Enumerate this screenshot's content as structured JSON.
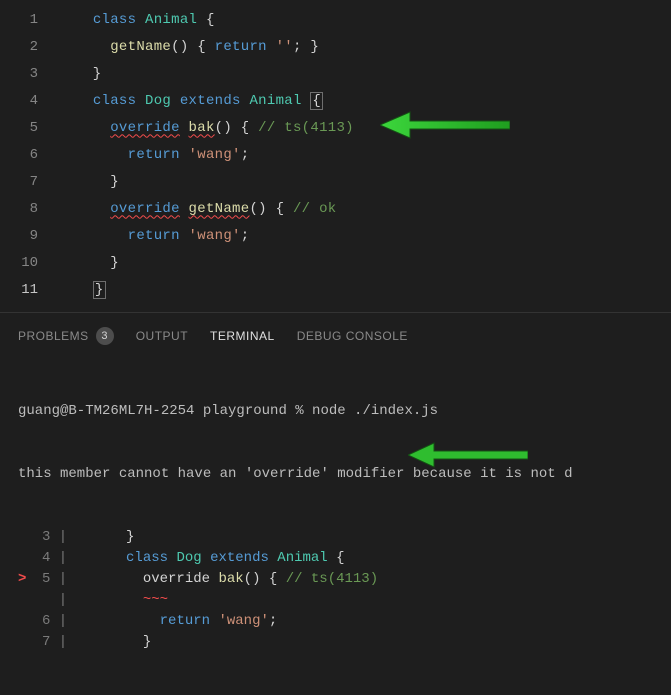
{
  "editor": {
    "lines": [
      {
        "n": "1",
        "tokens": [
          [
            "    ",
            "p"
          ],
          [
            "class",
            "kw"
          ],
          [
            " ",
            "p"
          ],
          [
            "Animal",
            "class"
          ],
          [
            " {",
            "p"
          ]
        ]
      },
      {
        "n": "2",
        "tokens": [
          [
            "      ",
            "p"
          ],
          [
            "getName",
            "fn"
          ],
          [
            "() { ",
            "p"
          ],
          [
            "return",
            "kw"
          ],
          [
            " ",
            "p"
          ],
          [
            "''",
            "str"
          ],
          [
            "; }",
            "p"
          ]
        ]
      },
      {
        "n": "3",
        "tokens": [
          [
            "    }",
            "p"
          ]
        ]
      },
      {
        "n": "4",
        "tokens": [
          [
            "    ",
            "p"
          ],
          [
            "class",
            "kw"
          ],
          [
            " ",
            "p"
          ],
          [
            "Dog",
            "class"
          ],
          [
            " ",
            "p"
          ],
          [
            "extends",
            "kw"
          ],
          [
            " ",
            "p"
          ],
          [
            "Animal",
            "class"
          ],
          [
            " ",
            "p"
          ],
          [
            "{",
            "box"
          ]
        ]
      },
      {
        "n": "5",
        "tokens": [
          [
            "      ",
            "p"
          ],
          [
            "override",
            "ov-sq"
          ],
          [
            " ",
            "p"
          ],
          [
            "bak",
            "fn-sq"
          ],
          [
            "() { ",
            "p"
          ],
          [
            "// ts(4113)",
            "comment"
          ]
        ]
      },
      {
        "n": "6",
        "tokens": [
          [
            "        ",
            "p"
          ],
          [
            "return",
            "kw"
          ],
          [
            " ",
            "p"
          ],
          [
            "'wang'",
            "str"
          ],
          [
            ";",
            "p"
          ]
        ]
      },
      {
        "n": "7",
        "tokens": [
          [
            "      }",
            "p"
          ]
        ]
      },
      {
        "n": "8",
        "tokens": [
          [
            "      ",
            "p"
          ],
          [
            "override",
            "ov-sq"
          ],
          [
            " ",
            "p"
          ],
          [
            "getName",
            "fn-sq"
          ],
          [
            "() { ",
            "p"
          ],
          [
            "// ok",
            "comment"
          ]
        ]
      },
      {
        "n": "9",
        "tokens": [
          [
            "        ",
            "p"
          ],
          [
            "return",
            "kw"
          ],
          [
            " ",
            "p"
          ],
          [
            "'wang'",
            "str"
          ],
          [
            ";",
            "p"
          ]
        ]
      },
      {
        "n": "10",
        "tokens": [
          [
            "      }",
            "p"
          ]
        ]
      },
      {
        "n": "11",
        "tokens": [
          [
            "    ",
            "p"
          ],
          [
            "}",
            "box"
          ]
        ],
        "active": true
      }
    ]
  },
  "panel": {
    "tabs": {
      "problems": "PROBLEMS",
      "problems_badge": "3",
      "output": "OUTPUT",
      "terminal": "TERMINAL",
      "debug": "DEBUG CONSOLE"
    },
    "term": {
      "prompt": "guang@B-TM26ML7H-2254 playground % node ./index.js",
      "err_msg": "this member cannot have an 'override' modifier because it is not d",
      "lines": [
        {
          "n": "3",
          "mark": " ",
          "tokens": [
            [
              "    }",
              "p"
            ]
          ]
        },
        {
          "n": "4",
          "mark": " ",
          "tokens": [
            [
              "    ",
              "p"
            ],
            [
              "class",
              "kw"
            ],
            [
              " ",
              "p"
            ],
            [
              "Dog",
              "class"
            ],
            [
              " ",
              "p"
            ],
            [
              "extends",
              "kw"
            ],
            [
              " ",
              "p"
            ],
            [
              "Animal",
              "class"
            ],
            [
              " {",
              "p"
            ]
          ]
        },
        {
          "n": "5",
          "mark": ">",
          "tokens": [
            [
              "      override ",
              "p"
            ],
            [
              "bak",
              "fn"
            ],
            [
              "() { ",
              "p"
            ],
            [
              "// ts(4113)",
              "comment"
            ]
          ]
        },
        {
          "n": "",
          "mark": " ",
          "tokens": [
            [
              "      ",
              "p"
            ],
            [
              "~~~",
              "caret"
            ]
          ]
        },
        {
          "n": "6",
          "mark": " ",
          "tokens": [
            [
              "        ",
              "p"
            ],
            [
              "return",
              "kw"
            ],
            [
              " ",
              "p"
            ],
            [
              "'wang'",
              "str"
            ],
            [
              ";",
              "p"
            ]
          ]
        },
        {
          "n": "7",
          "mark": " ",
          "tokens": [
            [
              "      }",
              "p"
            ]
          ]
        }
      ]
    }
  }
}
